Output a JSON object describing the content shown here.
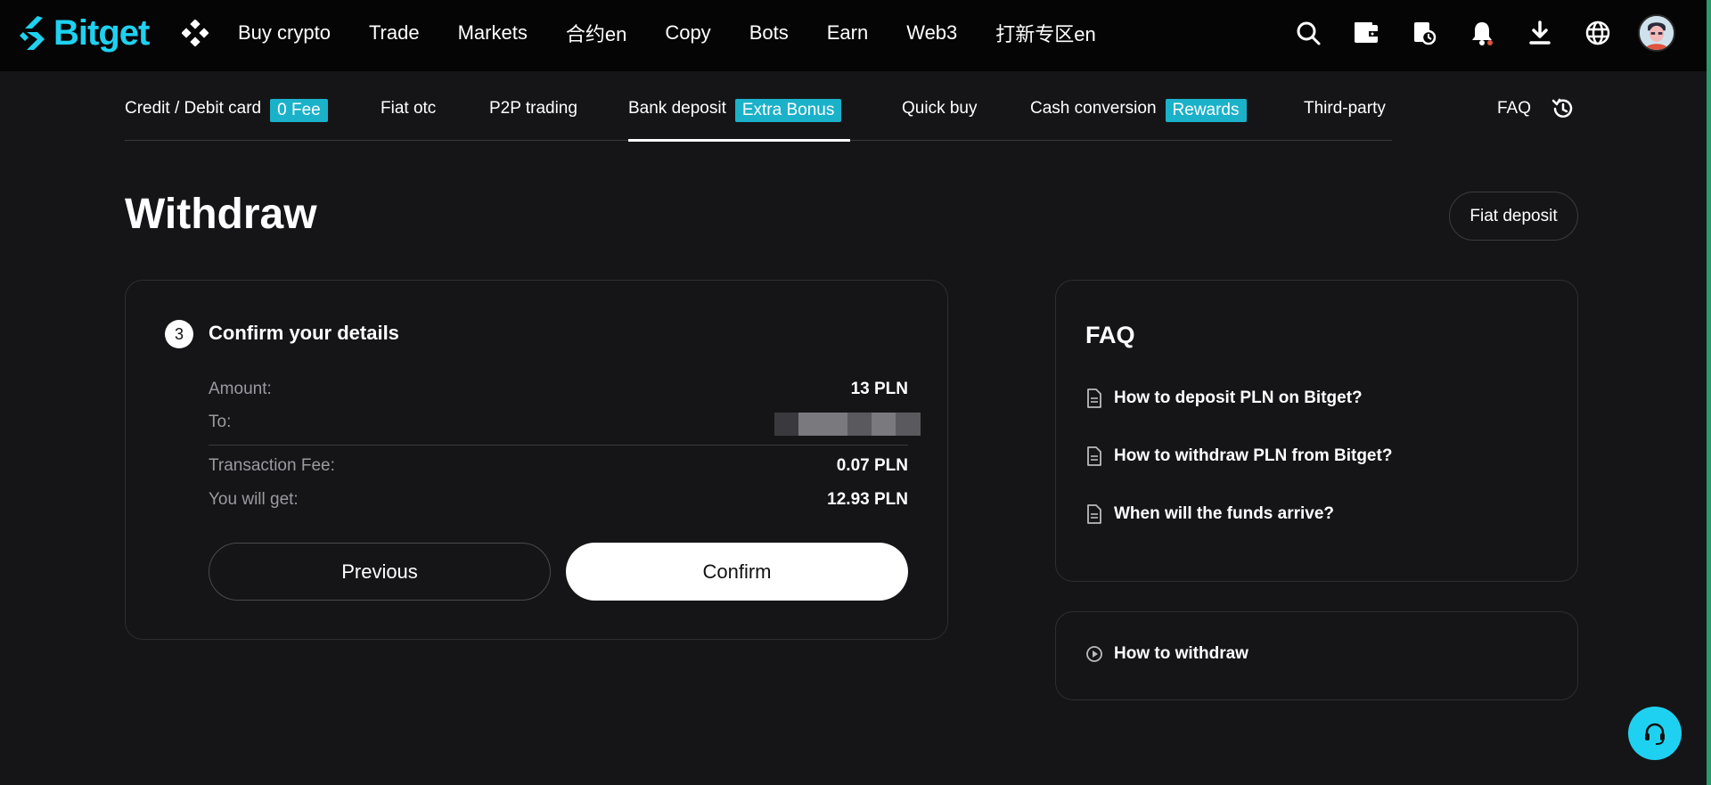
{
  "brand": {
    "name": "Bitget",
    "accent": "#1fd1f0"
  },
  "nav": {
    "links": [
      {
        "label": "Buy crypto"
      },
      {
        "label": "Trade"
      },
      {
        "label": "Markets"
      },
      {
        "label": "合约en"
      },
      {
        "label": "Copy"
      },
      {
        "label": "Bots"
      },
      {
        "label": "Earn"
      },
      {
        "label": "Web3"
      },
      {
        "label": "打新专区en"
      }
    ],
    "icons": [
      "search-icon",
      "wallet-icon",
      "orders-icon",
      "bell-icon",
      "download-icon",
      "globe-icon",
      "avatar"
    ]
  },
  "subtabs": [
    {
      "label": "Credit / Debit card",
      "badge": "0 Fee"
    },
    {
      "label": "Fiat otc"
    },
    {
      "label": "P2P trading"
    },
    {
      "label": "Bank deposit",
      "badge": "Extra Bonus",
      "active": true
    },
    {
      "label": "Quick buy"
    },
    {
      "label": "Cash conversion",
      "badge": "Rewards"
    },
    {
      "label": "Third-party"
    }
  ],
  "faq_link": "FAQ",
  "page": {
    "title": "Withdraw",
    "fiat_deposit_label": "Fiat deposit"
  },
  "confirm": {
    "step": "3",
    "title": "Confirm your details",
    "amount_label": "Amount:",
    "amount_value": "13 PLN",
    "to_label": "To:",
    "fee_label": "Transaction Fee:",
    "fee_value": "0.07 PLN",
    "get_label": "You will get:",
    "get_value": "12.93 PLN",
    "previous_label": "Previous",
    "confirm_label": "Confirm"
  },
  "faq": {
    "title": "FAQ",
    "items": [
      {
        "label": "How to deposit PLN on Bitget?"
      },
      {
        "label": "How to withdraw PLN from Bitget?"
      },
      {
        "label": "When will the funds arrive?"
      }
    ]
  },
  "howto": {
    "label": "How to withdraw"
  }
}
